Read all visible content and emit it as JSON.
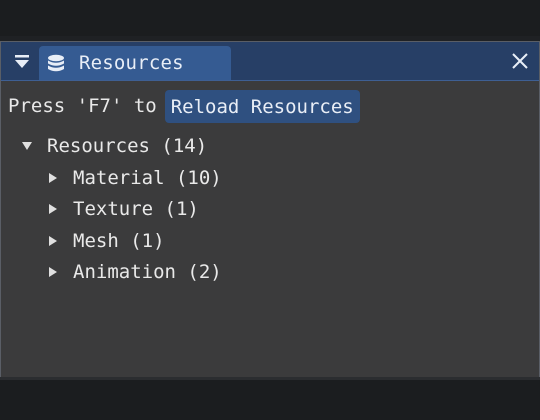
{
  "window": {
    "tab_title": "Resources"
  },
  "toolbar": {
    "hint_text": "Press 'F7' to",
    "reload_label": "Reload Resources"
  },
  "tree": {
    "root": "Resources (14)",
    "children": [
      "Material (10)",
      "Texture (1)",
      "Mesh (1)",
      "Animation (2)"
    ]
  },
  "colors": {
    "titlebar": "#273f66",
    "active_tab": "#355b92",
    "button": "#2f5080",
    "panel": "#3b3b3c"
  },
  "icons": {
    "menu": "triangle-down-icon",
    "tab": "database-icon",
    "close": "close-icon",
    "expanded": "triangle-down-icon",
    "collapsed": "triangle-right-icon"
  }
}
